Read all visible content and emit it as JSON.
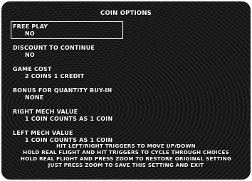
{
  "title": "COIN OPTIONS",
  "options": [
    {
      "label": "FREE PLAY",
      "value": "NO",
      "selected": true
    },
    {
      "label": "DISCOUNT TO CONTINUE",
      "value": "NO",
      "selected": false
    },
    {
      "label": "GAME COST",
      "value": "2 COINS 1 CREDIT",
      "selected": false
    },
    {
      "label": "BONUS FOR QUANTITY BUY-IN",
      "value": "NONE",
      "selected": false
    },
    {
      "label": "RIGHT MECH VALUE",
      "value": "1 COIN COUNTS AS 1 COIN",
      "selected": false
    },
    {
      "label": "LEFT MECH VALUE",
      "value": "1 COIN COUNTS AS 1 COIN",
      "selected": false
    }
  ],
  "instructions": [
    "HIT LEFT/RIGHT TRIGGERS TO MOVE UP/DOWN",
    "HOLD REAL FLIGHT AND HIT TRIGGERS TO CYCLE THROUGH CHOICES",
    "HOLD REAL FLIGHT AND PRESS ZOOM TO RESTORE ORIGINAL SETTING",
    "JUST PRESS ZOOM TO SAVE THIS SETTING AND EXIT"
  ],
  "colors": {
    "text": "#ffffff",
    "background": "#111111"
  }
}
